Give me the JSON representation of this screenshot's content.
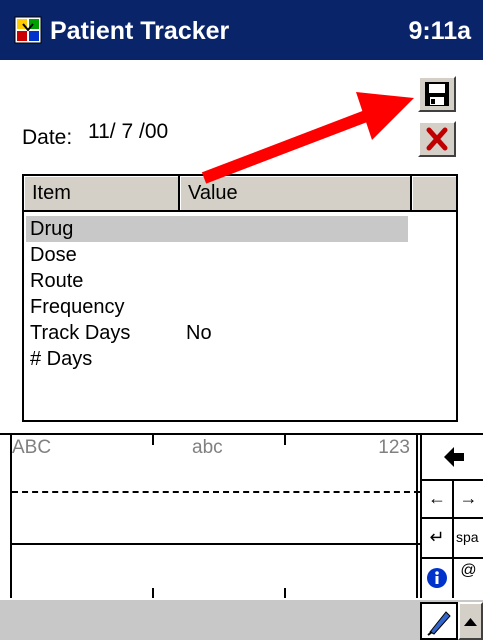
{
  "titlebar": {
    "title": "Patient Tracker",
    "time": "9:11a"
  },
  "form": {
    "date_label": "Date:",
    "date_value": "11/ 7 /00"
  },
  "grid": {
    "headers": {
      "item": "Item",
      "value": "Value",
      "extra": ""
    },
    "rows": [
      {
        "item": "Drug",
        "value": "",
        "selected": true
      },
      {
        "item": "Dose",
        "value": ""
      },
      {
        "item": "Route",
        "value": ""
      },
      {
        "item": "Frequency",
        "value": ""
      },
      {
        "item": "Track Days",
        "value": "No"
      },
      {
        "item": "# Days",
        "value": ""
      }
    ]
  },
  "keyboard": {
    "labels": {
      "upper": "ABC",
      "lower": "abc",
      "numbers": "123"
    },
    "keys": {
      "space_partial": "spa"
    }
  },
  "icons": {
    "app": "patient-tracker-app-icon",
    "save": "floppy-disk-icon",
    "cancel": "red-x-icon",
    "annotation": "red-arrow-pointing-to-save"
  },
  "colors": {
    "titlebar": "#0a246a",
    "annotation_arrow": "#ff0000",
    "selection": "#c8c8c8"
  }
}
